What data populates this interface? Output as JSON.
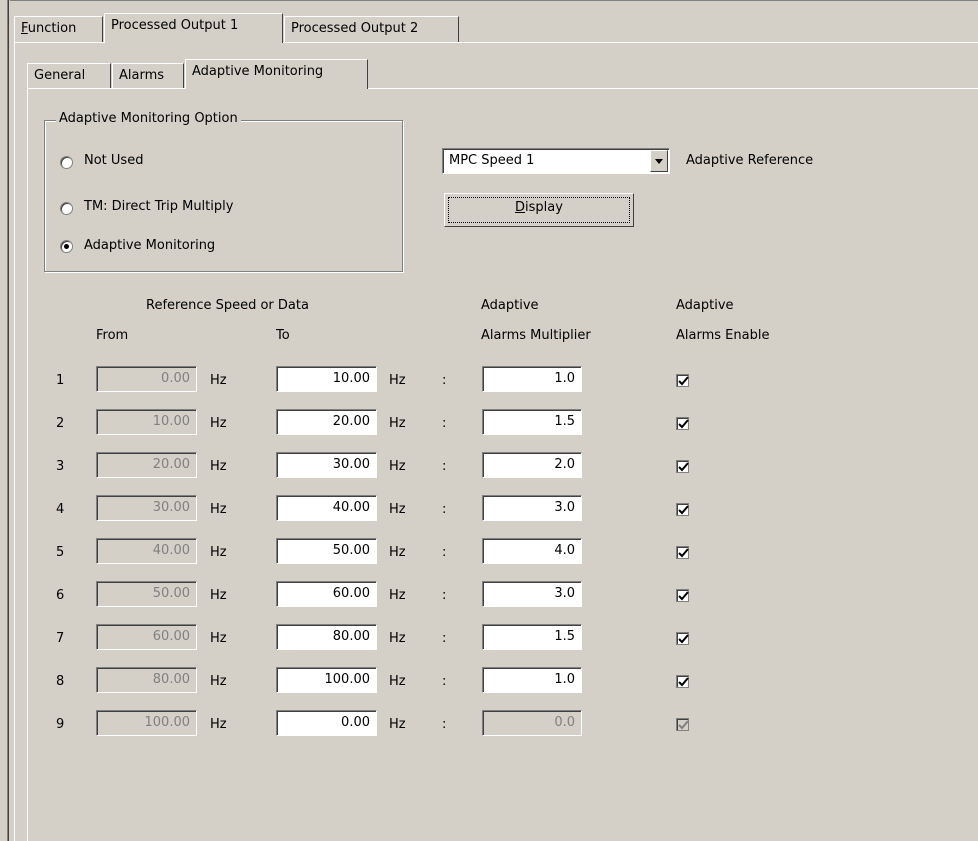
{
  "tabs_top": [
    {
      "label": "Function",
      "mnemonic": "F"
    },
    {
      "label": "Processed Output 1"
    },
    {
      "label": "Processed Output 2"
    }
  ],
  "tabs_sub": [
    {
      "label": "General"
    },
    {
      "label": "Alarms"
    },
    {
      "label": "Adaptive Monitoring"
    }
  ],
  "option_group": {
    "title": "Adaptive Monitoring Option",
    "options": [
      {
        "label": "Not Used",
        "checked": false
      },
      {
        "label": "TM: Direct Trip Multiply",
        "checked": false
      },
      {
        "label": "Adaptive Monitoring",
        "checked": true
      }
    ]
  },
  "reference": {
    "selected": "MPC Speed 1",
    "label": "Adaptive Reference",
    "display_button": "Display"
  },
  "headers": {
    "ref_speed": "Reference Speed or Data",
    "from": "From",
    "to": "To",
    "multiplier_1": "Adaptive",
    "multiplier_2": "Alarms Multiplier",
    "enable_1": "Adaptive",
    "enable_2": "Alarms Enable"
  },
  "unit": "Hz",
  "sep": ":",
  "rows": [
    {
      "n": "1",
      "from": "0.00",
      "to": "10.00",
      "mult": "1.0",
      "enabled": true,
      "disabled": false
    },
    {
      "n": "2",
      "from": "10.00",
      "to": "20.00",
      "mult": "1.5",
      "enabled": true,
      "disabled": false
    },
    {
      "n": "3",
      "from": "20.00",
      "to": "30.00",
      "mult": "2.0",
      "enabled": true,
      "disabled": false
    },
    {
      "n": "4",
      "from": "30.00",
      "to": "40.00",
      "mult": "3.0",
      "enabled": true,
      "disabled": false
    },
    {
      "n": "5",
      "from": "40.00",
      "to": "50.00",
      "mult": "4.0",
      "enabled": true,
      "disabled": false
    },
    {
      "n": "6",
      "from": "50.00",
      "to": "60.00",
      "mult": "3.0",
      "enabled": true,
      "disabled": false
    },
    {
      "n": "7",
      "from": "60.00",
      "to": "80.00",
      "mult": "1.5",
      "enabled": true,
      "disabled": false
    },
    {
      "n": "8",
      "from": "80.00",
      "to": "100.00",
      "mult": "1.0",
      "enabled": true,
      "disabled": false
    },
    {
      "n": "9",
      "from": "100.00",
      "to": "0.00",
      "mult": "0.0",
      "enabled": true,
      "disabled": true
    }
  ]
}
